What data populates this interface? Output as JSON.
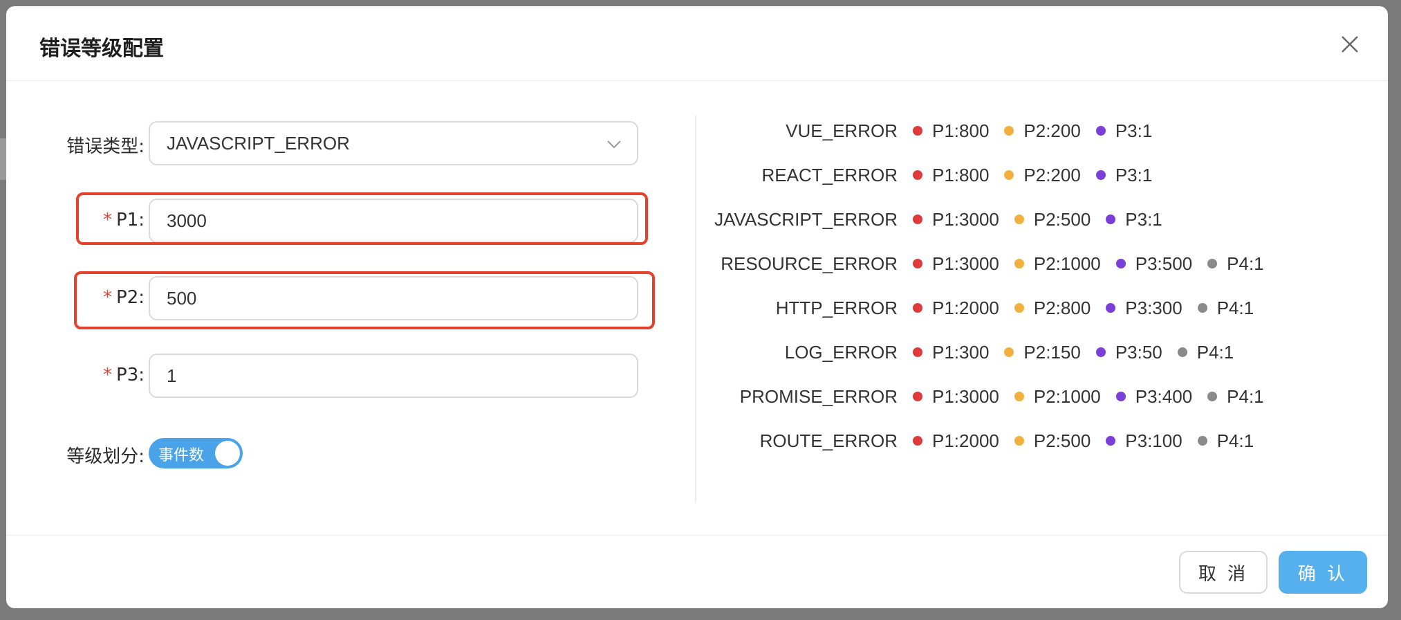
{
  "dialog": {
    "title": "错误等级配置"
  },
  "form": {
    "error_type_label": "错误类型:",
    "error_type_value": "JAVASCRIPT_ERROR",
    "p1_label": "P1:",
    "p1_value": "3000",
    "p2_label": "P2:",
    "p2_value": "500",
    "p3_label": "P3:",
    "p3_value": "1",
    "required_mark": "*",
    "grade_label": "等级划分:",
    "grade_toggle_text": "事件数",
    "grade_toggle_on": true
  },
  "levels": [
    {
      "type": "VUE_ERROR",
      "p": [
        "P1:800",
        "P2:200",
        "P3:1"
      ]
    },
    {
      "type": "REACT_ERROR",
      "p": [
        "P1:800",
        "P2:200",
        "P3:1"
      ]
    },
    {
      "type": "JAVASCRIPT_ERROR",
      "p": [
        "P1:3000",
        "P2:500",
        "P3:1"
      ]
    },
    {
      "type": "RESOURCE_ERROR",
      "p": [
        "P1:3000",
        "P2:1000",
        "P3:500",
        "P4:1"
      ]
    },
    {
      "type": "HTTP_ERROR",
      "p": [
        "P1:2000",
        "P2:800",
        "P3:300",
        "P4:1"
      ]
    },
    {
      "type": "LOG_ERROR",
      "p": [
        "P1:300",
        "P2:150",
        "P3:50",
        "P4:1"
      ]
    },
    {
      "type": "PROMISE_ERROR",
      "p": [
        "P1:3000",
        "P2:1000",
        "P3:400",
        "P4:1"
      ]
    },
    {
      "type": "ROUTE_ERROR",
      "p": [
        "P1:2000",
        "P2:500",
        "P3:100",
        "P4:1"
      ]
    }
  ],
  "level_colors": [
    "#e03a3a",
    "#f0b13e",
    "#7a3fd9",
    "#8a8a8a"
  ],
  "footer": {
    "cancel_label": "取 消",
    "confirm_label": "确 认"
  },
  "icons": {
    "close": "close-icon",
    "dropdown": "chevron-down-icon"
  }
}
